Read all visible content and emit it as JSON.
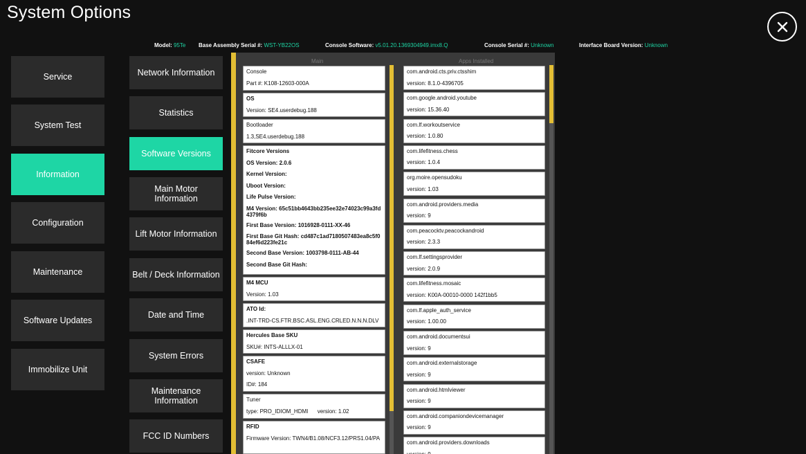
{
  "header": {
    "title": "System Options"
  },
  "info": [
    {
      "label": "Model:",
      "value": "95Te"
    },
    {
      "label": "Base Assembly Serial #:",
      "value": "WST-YB22OS"
    },
    {
      "label": "Console Software:",
      "value": "v5.01.20.1369304949.imx8.Q"
    },
    {
      "label": "Console Serial #:",
      "value": "Unknown"
    },
    {
      "label": "Interface Board Version:",
      "value": "Unknown"
    }
  ],
  "sidebar": [
    "Service",
    "System Test",
    "Information",
    "Configuration",
    "Maintenance",
    "Software Updates",
    "Immobilize Unit"
  ],
  "subnav": [
    "Network Information",
    "Statistics",
    "Software Versions",
    "Main Motor Information",
    "Lift Motor Information",
    "Belt / Deck Information",
    "Date and Time",
    "System Errors",
    "Maintenance Information",
    "FCC ID Numbers"
  ],
  "main_header": "Main",
  "apps_header": "Apps Installed",
  "main_cards": [
    [
      "Console",
      "Part #: K108-12603-000A"
    ],
    [
      "OS",
      "Version: SE4.userdebug.188"
    ],
    [
      "Bootloader",
      "1.3,SE4.userdebug.188"
    ],
    [
      "Fitcore Versions",
      "OS Version: 2.0.6",
      "Kernel Version:",
      "Uboot Version:",
      "Life Pulse Version:",
      "M4 Version: 65c51bb4643bb235ee32e74023c99a3fd4379f6b",
      "First Base Version: 1016928-0111-XX-46",
      "First Base Git Hash: cd487c1ad7180507483ea8c5f084ef6d223fe21c",
      "Second Base Version: 1003798-0111-AB-44",
      "Second Base Git Hash:"
    ],
    [
      "M4 MCU",
      "Version: 1.03"
    ],
    [
      "ATO Id:",
      ".INT-TRD-CS.FTR.BSC.ASL.ENG.CRLED.N.N.N.DLV"
    ],
    [
      "Hercules Base SKU",
      "SKU#: INTS-ALLLX-01"
    ],
    [
      "CSAFE",
      "version: Unknown",
      "ID#: 184"
    ],
    [
      "Tuner",
      "type: PRO_IDIOM_HDMI      version: 1.02"
    ],
    [
      "RFID",
      "Firmware Version: TWN4/B1.08/NCF3.12/PRS1.04/PA"
    ]
  ],
  "apps": [
    [
      "com.android.cts.priv.ctsshim",
      "version: 8.1.0-4396705"
    ],
    [
      "com.google.android.youtube",
      "version: 15.36.40"
    ],
    [
      "com.lf.workoutservice",
      "version: 1.0.80"
    ],
    [
      "com.lifefitness.chess",
      "version: 1.0.4"
    ],
    [
      "org.moire.opensudoku",
      "version: 1.03"
    ],
    [
      "com.android.providers.media",
      "version: 9"
    ],
    [
      "com.peacocktv.peacockandroid",
      "version: 2.3.3"
    ],
    [
      "com.lf.settingsprovider",
      "version: 2.0.9"
    ],
    [
      "com.lifefitness.mosaic",
      "version: K00A-00010-0000 142f1bb5"
    ],
    [
      "com.lf.apple_auth_service",
      "version: 1.00.00"
    ],
    [
      "com.android.documentsui",
      "version: 9"
    ],
    [
      "com.android.externalstorage",
      "version: 9"
    ],
    [
      "com.android.htmlviewer",
      "version: 9"
    ],
    [
      "com.android.companiondevicemanager",
      "version: 9"
    ],
    [
      "com.android.providers.downloads",
      "version: 9"
    ]
  ]
}
